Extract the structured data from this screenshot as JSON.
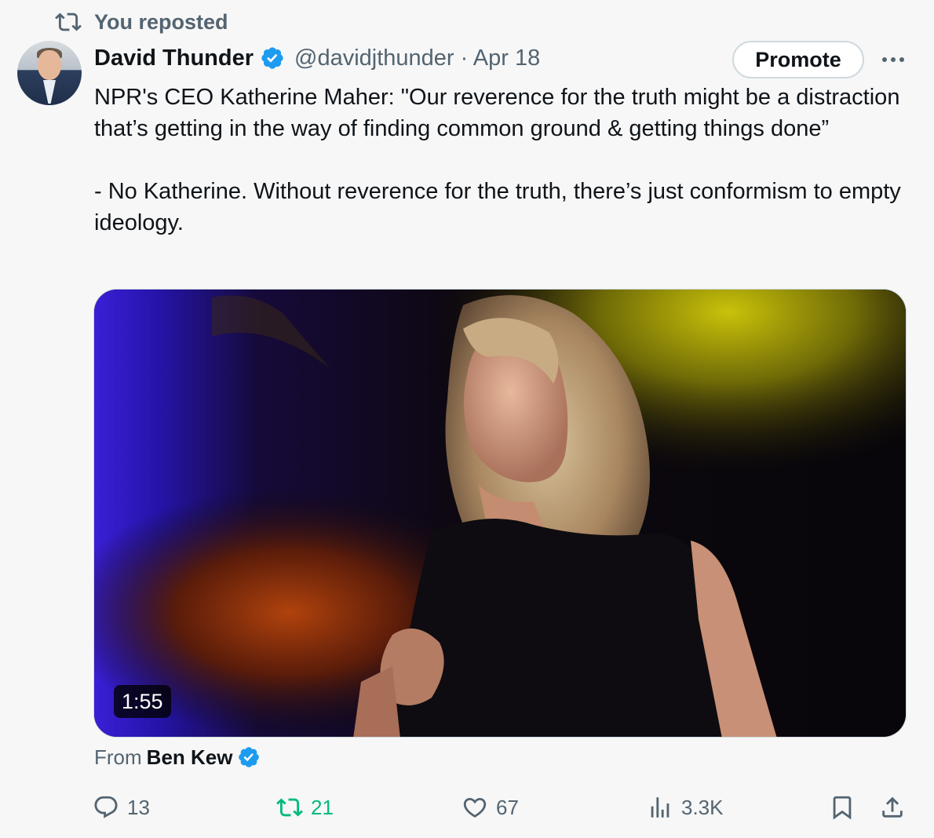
{
  "repost_banner": {
    "text": "You reposted"
  },
  "author": {
    "display_name": "David Thunder",
    "handle_date": "@davidjthunder · Apr 18"
  },
  "header_actions": {
    "promote_label": "Promote"
  },
  "tweet": {
    "paragraphs": [
      "NPR's CEO Katherine Maher: \"Our reverence for the truth might be a distraction that’s getting in the way of finding common ground & getting things done”",
      "- No Katherine. Without reverence for the truth, there’s just conformism to empty ideology."
    ]
  },
  "media": {
    "duration": "1:55"
  },
  "attribution": {
    "prefix": "From",
    "source_name": "Ben Kew"
  },
  "actions": {
    "replies": "13",
    "reposts": "21",
    "likes": "67",
    "views": "3.3K"
  },
  "colors": {
    "verified_blue": "#1d9bf0",
    "repost_green": "#00ba7c",
    "secondary_text": "#536471"
  }
}
